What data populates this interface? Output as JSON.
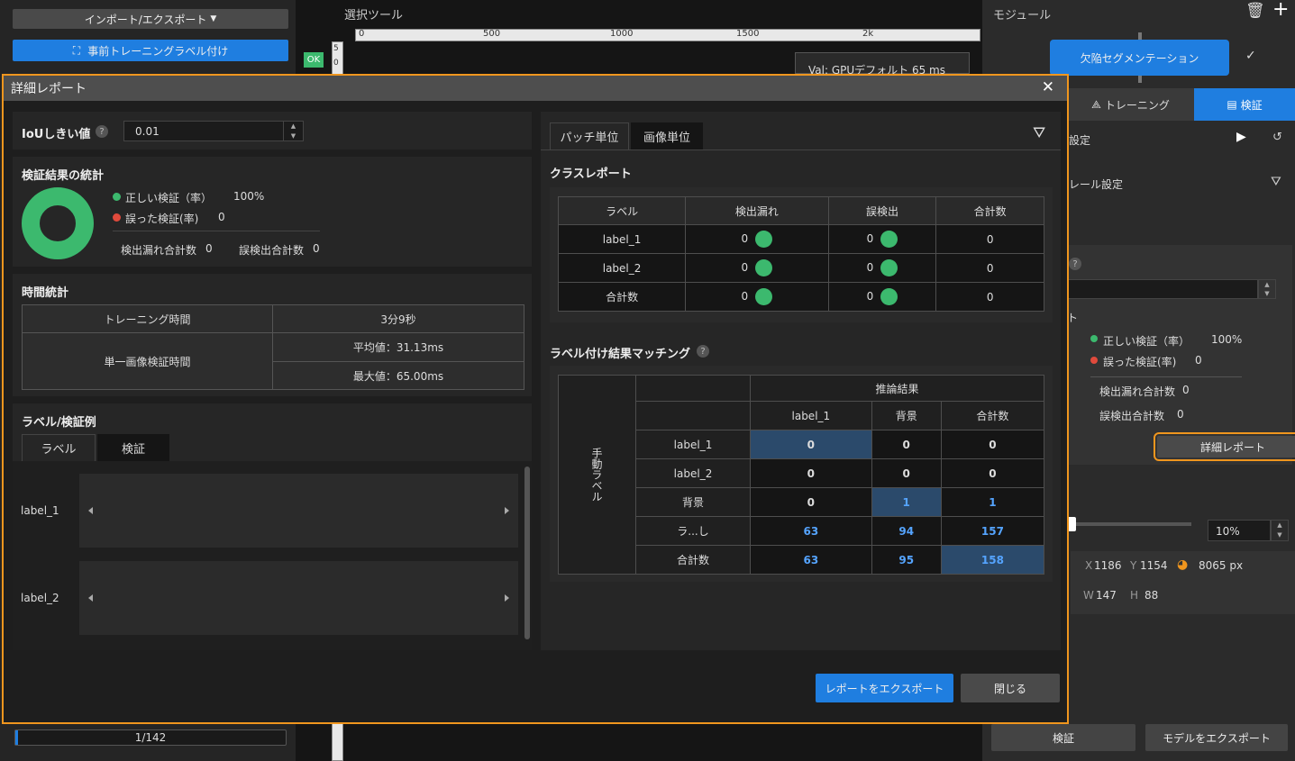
{
  "left": {
    "import_export": "インポート/エクスポート",
    "pretrain_label": "事前トレーニングラベル付け",
    "pagination": "1/142"
  },
  "canvas": {
    "select_tool": "選択ツール",
    "ok_badge": "OK",
    "ruler": [
      "0",
      "500",
      "1000",
      "1500",
      "2k"
    ],
    "val_text": "Val: GPUデフォルト 65 ms",
    "side_ticks": [
      "5",
      "0"
    ]
  },
  "right": {
    "module_title": "モジュール",
    "module_button": "欠陥セグメンテーション",
    "tab_training": "トレーニング",
    "tab_validate": "検証",
    "settings_partial": "設定",
    "rule_settings": "レール設定",
    "stats_correct": "正しい検証（率）",
    "stats_correct_value": "100%",
    "stats_wrong": "誤った検証(率)",
    "stats_wrong_value": "0",
    "missed_total": "検出漏れ合計数",
    "missed_total_value": "0",
    "false_total": "誤検出合計数",
    "false_total_value": "0",
    "detail_report": "詳細レポート",
    "zoom": "10%",
    "coord_x_label": "X",
    "coord_x": "1186",
    "coord_y_label": "Y",
    "coord_y": "1154",
    "area": "8065 px",
    "coord_w_label": "W",
    "coord_w": "147",
    "coord_h_label": "H",
    "coord_h": "88",
    "bottom_validate": "検証",
    "bottom_export": "モデルをエクスポート",
    "help": "?",
    "partial_char": "ト"
  },
  "dialog": {
    "title": "詳細レポート",
    "iou_label": "IoUしきい値",
    "iou_value": "0.01",
    "help": "?",
    "stats_title": "検証結果の統計",
    "correct_label": "正しい検証（率）",
    "correct_value": "100%",
    "wrong_label": "誤った検証(率)",
    "wrong_value": "0",
    "missed_label": "検出漏れ合計数",
    "missed_value": "0",
    "false_label": "誤検出合計数",
    "false_value": "0",
    "time_title": "時間統計",
    "training_time_label": "トレーニング時間",
    "training_time_value": "3分9秒",
    "single_image_label": "単一画像検証時間",
    "avg_value": "平均値：31.13ms",
    "max_value": "最大値：65.00ms",
    "examples_title": "ラベル/検証例",
    "tab_label": "ラベル",
    "tab_validate": "検証",
    "example_rows": [
      "label_1",
      "label_2"
    ],
    "tab_patch": "パッチ単位",
    "tab_image": "画像単位",
    "class_report_title": "クラスレポート",
    "class_headers": [
      "ラベル",
      "検出漏れ",
      "誤検出",
      "合計数"
    ],
    "class_rows": [
      {
        "label": "label_1",
        "missed": "0",
        "false": "0",
        "total": "0"
      },
      {
        "label": "label_2",
        "missed": "0",
        "false": "0",
        "total": "0"
      },
      {
        "label": "合計数",
        "missed": "0",
        "false": "0",
        "total": "0"
      }
    ],
    "matching_title": "ラベル付け結果マッチング",
    "inference_header": "推論結果",
    "manual_label": "手動ラベル",
    "matrix_cols": [
      "label_1",
      "背景",
      "合計数"
    ],
    "matrix_rows": [
      {
        "label": "label_1",
        "values": [
          "0",
          "0",
          "0"
        ]
      },
      {
        "label": "label_2",
        "values": [
          "0",
          "0",
          "0"
        ]
      },
      {
        "label": "背景",
        "values": [
          "0",
          "1",
          "1"
        ]
      },
      {
        "label": "ラ...し",
        "values": [
          "63",
          "94",
          "157"
        ]
      },
      {
        "label": "合計数",
        "values": [
          "63",
          "95",
          "158"
        ]
      }
    ],
    "export_button": "レポートをエクスポート",
    "close_button": "閉じる"
  },
  "colors": {
    "accent": "#1f7ee0",
    "highlight": "#f0961e",
    "ok": "#3cb96e",
    "error": "#e04a3c"
  }
}
